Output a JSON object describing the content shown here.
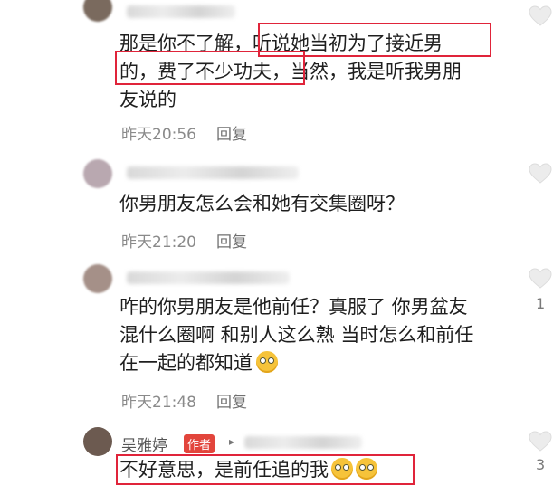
{
  "comments": [
    {
      "text_lines": [
        "那是你不了解，听说她当初为了接近男",
        "的，费了不少功夫，当然，我是听我男朋",
        "友说的"
      ],
      "time": "昨天20:56",
      "reply_label": "回复",
      "likes": ""
    },
    {
      "text_lines": [
        "你男朋友怎么会和她有交集圈呀？"
      ],
      "time": "昨天21:20",
      "reply_label": "回复",
      "likes": ""
    },
    {
      "text_lines": [
        "咋的你男朋友是他前任？真服了 你男盆友",
        "混什么圈啊 和别人这么熟 当时怎么和前任",
        "在一起的都知道"
      ],
      "time": "昨天21:48",
      "reply_label": "回复",
      "likes": "1"
    },
    {
      "author": "吴雅婷",
      "badge": "作者",
      "reply_marker": "▸",
      "text_lines": [
        "不好意思，是前任追的我"
      ],
      "likes": "3"
    }
  ],
  "colors": {
    "highlight_box": "#e0243a",
    "author_badge": "#e2453c"
  },
  "icons": {
    "like": "heart-outline-icon",
    "emoji": "smiling-face-icon"
  }
}
